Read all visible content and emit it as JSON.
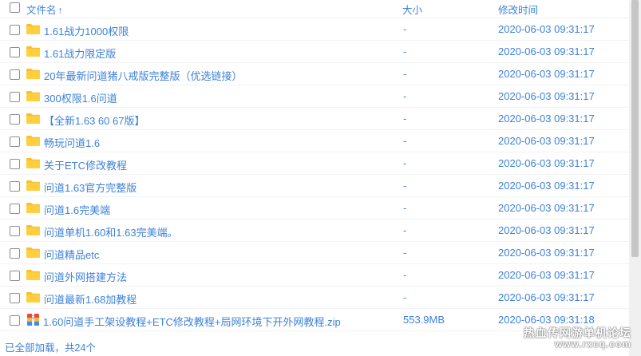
{
  "header": {
    "name_label": "文件名",
    "sort_arrow": "↑",
    "size_label": "大小",
    "time_label": "修改时间"
  },
  "files": [
    {
      "name": "1.61战力1000权限",
      "size": "-",
      "time": "2020-06-03 09:31:17",
      "icon": "folder-icon"
    },
    {
      "name": "1.61战力限定版",
      "size": "-",
      "time": "2020-06-03 09:31:17",
      "icon": "folder-icon"
    },
    {
      "name": "20年最新问道猪八戒版完整版（优选链接）",
      "size": "-",
      "time": "2020-06-03 09:31:17",
      "icon": "folder-icon"
    },
    {
      "name": "300权限1.6问道",
      "size": "-",
      "time": "2020-06-03 09:31:17",
      "icon": "folder-icon"
    },
    {
      "name": "【全新1.63 60 67版】",
      "size": "-",
      "time": "2020-06-03 09:31:17",
      "icon": "folder-icon"
    },
    {
      "name": "畅玩问道1.6",
      "size": "-",
      "time": "2020-06-03 09:31:17",
      "icon": "folder-icon"
    },
    {
      "name": "关于ETC修改教程",
      "size": "-",
      "time": "2020-06-03 09:31:17",
      "icon": "folder-icon"
    },
    {
      "name": "问道1.63官方完整版",
      "size": "-",
      "time": "2020-06-03 09:31:17",
      "icon": "folder-icon"
    },
    {
      "name": "问道1.6完美端",
      "size": "-",
      "time": "2020-06-03 09:31:17",
      "icon": "folder-icon"
    },
    {
      "name": "问道单机1.60和1.63完美端。",
      "size": "-",
      "time": "2020-06-03 09:31:17",
      "icon": "folder-icon"
    },
    {
      "name": "问道精品etc",
      "size": "-",
      "time": "2020-06-03 09:31:17",
      "icon": "folder-icon"
    },
    {
      "name": "问道外网搭建方法",
      "size": "-",
      "time": "2020-06-03 09:31:17",
      "icon": "folder-icon"
    },
    {
      "name": "问道最新1.68加教程",
      "size": "-",
      "time": "2020-06-03 09:31:17",
      "icon": "folder-icon"
    },
    {
      "name": "1.60问道手工架设教程+ETC修改教程+局网环境下开外网教程.zip",
      "size": "553.9MB",
      "time": "2020-06-03 09:31:18",
      "icon": "zip-archive-icon"
    }
  ],
  "footer": {
    "status": "已全部加载，共24个"
  },
  "watermark": {
    "line1": "热血传网游单机论坛",
    "line2": "www.rxcq.com"
  },
  "colors": {
    "link": "#3d82d9",
    "folder": "#f8c12c",
    "border": "#eef0f4"
  }
}
